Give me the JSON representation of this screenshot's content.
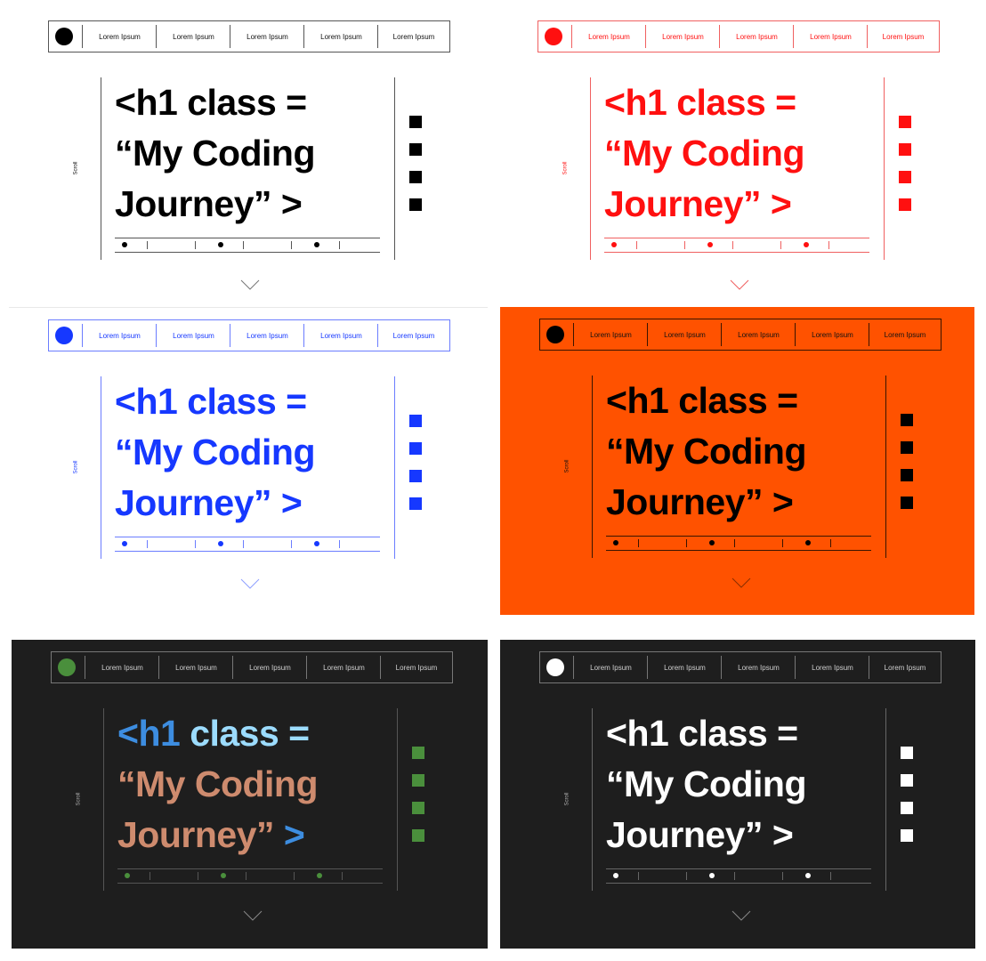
{
  "nav_items": [
    "Lorem Ipsum",
    "Lorem Ipsum",
    "Lorem Ipsum",
    "Lorem Ipsum",
    "Lorem Ipsum"
  ],
  "scroll_label": "Scroll",
  "headline": {
    "line1_a": "<h1",
    "line1_b": " class =",
    "line2": "“My Coding",
    "line3_a": "Journey”",
    "line3_b": " >"
  },
  "themes": [
    {
      "name": "black",
      "bg": "#ffffff",
      "line": "#555555",
      "text": "#000000",
      "accent": "#000000"
    },
    {
      "name": "red",
      "bg": "#ffffff",
      "line": "#f06060",
      "text": "#ff1010",
      "accent": "#ff1010"
    },
    {
      "name": "blue",
      "bg": "#ffffff",
      "line": "#6b7dff",
      "text": "#1638ff",
      "accent": "#1638ff"
    },
    {
      "name": "orange",
      "bg": "#ff5200",
      "line": "#3a1400",
      "text": "#000000",
      "accent": "#000000"
    },
    {
      "name": "code-dark",
      "bg": "#1e1e1e",
      "line": "#555555",
      "text_tag": "#3d8de0",
      "text_attr": "#9cdcfe",
      "text_string": "#ce8b6e",
      "accent": "#4a8f3c"
    },
    {
      "name": "white-dark",
      "bg": "#1e1e1e",
      "line": "#666666",
      "text": "#ffffff",
      "accent": "#ffffff"
    }
  ]
}
